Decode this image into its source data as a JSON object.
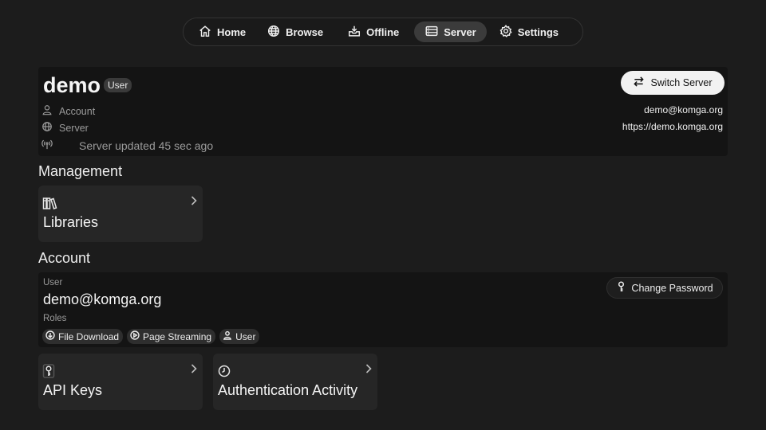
{
  "nav": {
    "items": [
      {
        "label": "Home",
        "icon": "home-icon",
        "active": false
      },
      {
        "label": "Browse",
        "icon": "globe-icon",
        "active": false
      },
      {
        "label": "Offline",
        "icon": "inbox-download-icon",
        "active": false
      },
      {
        "label": "Server",
        "icon": "server-icon",
        "active": true
      },
      {
        "label": "Settings",
        "icon": "gear-icon",
        "active": false
      }
    ]
  },
  "server": {
    "name": "demo",
    "role_badge": "User",
    "account_label": "Account",
    "server_label": "Server",
    "status": "Server updated 45 sec ago",
    "switch_label": "Switch Server",
    "account_value": "demo@komga.org",
    "server_value": "https://demo.komga.org"
  },
  "management": {
    "title": "Management",
    "libraries_label": "Libraries"
  },
  "account": {
    "title": "Account",
    "user_label": "User",
    "email": "demo@komga.org",
    "roles_label": "Roles",
    "roles": [
      "File Download",
      "Page Streaming",
      "User"
    ],
    "change_password_label": "Change Password",
    "api_keys_label": "API Keys",
    "auth_activity_label": "Authentication Activity"
  },
  "colors": {
    "background": "#1c1c1c",
    "panel": "#141414",
    "card": "#262626",
    "accent_button": "#f2f2f2"
  }
}
